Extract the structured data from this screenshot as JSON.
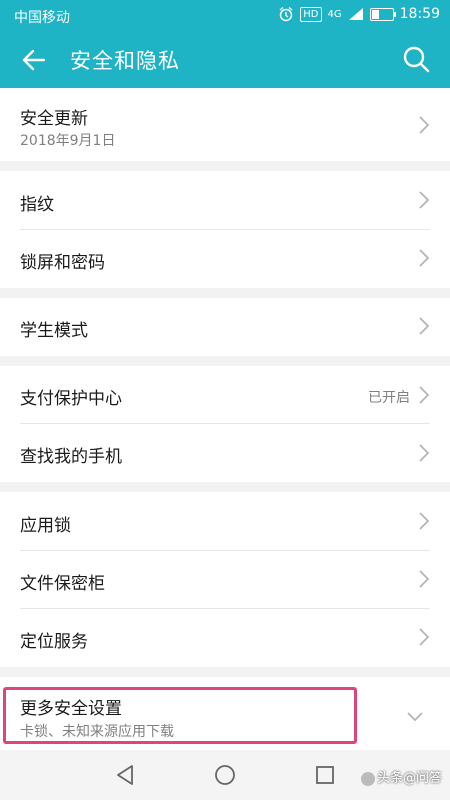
{
  "status_bar": {
    "carrier": "中国移动",
    "hd_badge": "HD",
    "signal": "4G",
    "time": "18:59"
  },
  "app_bar": {
    "title": "安全和隐私",
    "icons": [
      "back-arrow-icon",
      "search-icon"
    ]
  },
  "rows": {
    "security_update": {
      "label": "安全更新",
      "sub": "2018年9月1日"
    },
    "fingerprint": {
      "label": "指纹"
    },
    "lock_screen": {
      "label": "锁屏和密码"
    },
    "student_mode": {
      "label": "学生模式"
    },
    "payment_protection": {
      "label": "支付保护中心",
      "value": "已开启"
    },
    "find_my_phone": {
      "label": "查找我的手机"
    },
    "app_lock": {
      "label": "应用锁"
    },
    "file_safe": {
      "label": "文件保密柜"
    },
    "location": {
      "label": "定位服务"
    },
    "more_security": {
      "label": "更多安全设置",
      "sub": "卡锁、未知来源应用下载"
    }
  },
  "nav_bar": {
    "icons": [
      "back-triangle-icon",
      "home-circle-icon",
      "recents-square-icon"
    ]
  },
  "watermark": "头条@问答",
  "colors": {
    "accent": "#1fb3c6",
    "highlight": "#e0457a"
  }
}
